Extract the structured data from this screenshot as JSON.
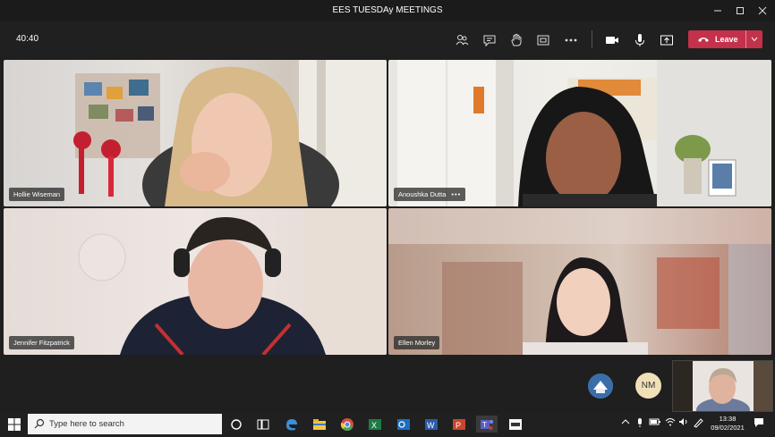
{
  "window": {
    "title": "EES TUESDAy MEETINGS",
    "minimize_icon": "minimize-icon",
    "maximize_icon": "maximize-icon",
    "close_icon": "close-icon"
  },
  "toolbar": {
    "timer": "40:40",
    "leave_label": "Leave",
    "leave_color": "#c4314b",
    "icons": [
      "participants-icon",
      "chat-icon",
      "raise-hand-icon",
      "share-tray-icon",
      "more-icon",
      "camera-icon",
      "mic-icon",
      "share-screen-icon"
    ]
  },
  "participants": [
    {
      "name": "Hollie Wiseman",
      "more": ""
    },
    {
      "name": "Anoushka Dutta",
      "more": "•••"
    },
    {
      "name": "Jennifer Fitzpatrick",
      "more": ""
    },
    {
      "name": "Ellen Morley",
      "more": ""
    }
  ],
  "bottom": {
    "avatar_initials": "NM"
  },
  "taskbar": {
    "search_placeholder": "Type here to search",
    "time": "13:38",
    "date": "09/02/2021",
    "apps": [
      "start-icon",
      "search-icon",
      "cortana-icon",
      "task-view-icon",
      "edge-icon",
      "file-explorer-icon",
      "chrome-icon",
      "excel-icon",
      "outlook-icon",
      "word-icon",
      "powerpoint-icon",
      "teams-icon",
      "app-icon"
    ]
  }
}
